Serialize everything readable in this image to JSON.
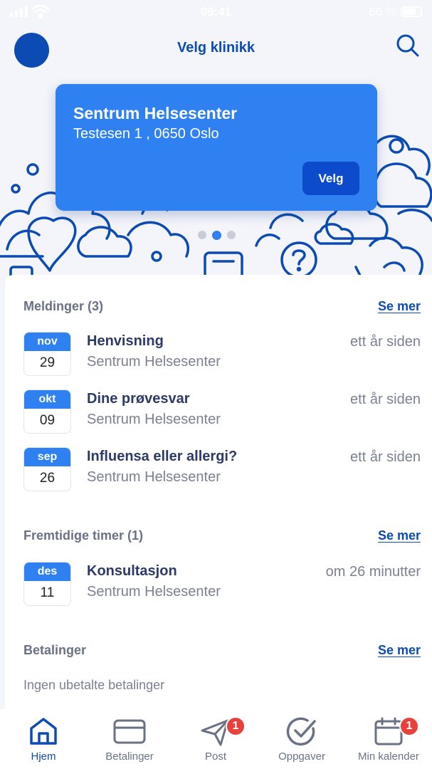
{
  "status_bar": {
    "time": "09:41",
    "battery_percent": "66 %"
  },
  "header": {
    "title": "Velg klinikk",
    "avatar_icon": "avatar",
    "search_icon": "search-icon"
  },
  "clinic_card": {
    "name": "Sentrum Helsesenter",
    "address": "Testesen 1 , 0650 Oslo",
    "select_label": "Velg",
    "pager_total": 3,
    "pager_active": 2
  },
  "messages": {
    "title": "Meldinger (3)",
    "see_more": "Se mer",
    "items": [
      {
        "month": "nov",
        "day": "29",
        "title": "Henvisning",
        "subtitle": "Sentrum Helsesenter",
        "time": "ett år siden"
      },
      {
        "month": "okt",
        "day": "09",
        "title": "Dine prøvesvar",
        "subtitle": "Sentrum Helsesenter",
        "time": "ett år siden"
      },
      {
        "month": "sep",
        "day": "26",
        "title": "Influensa eller allergi?",
        "subtitle": "Sentrum Helsesenter",
        "time": "ett år siden"
      }
    ]
  },
  "appointments": {
    "title": "Fremtidige timer (1)",
    "see_more": "Se mer",
    "items": [
      {
        "month": "des",
        "day": "11",
        "title": "Konsultasjon",
        "subtitle": "Sentrum Helsesenter",
        "time": "om 26 minutter"
      }
    ]
  },
  "payments": {
    "title": "Betalinger",
    "see_more": "Se mer",
    "empty_text": "Ingen ubetalte betalinger"
  },
  "nav": {
    "items": [
      {
        "label": "Hjem",
        "icon": "home-icon",
        "active": true
      },
      {
        "label": "Betalinger",
        "icon": "credit-card-icon"
      },
      {
        "label": "Post",
        "icon": "send-icon",
        "badge": "1"
      },
      {
        "label": "Oppgaver",
        "icon": "check-circle-icon"
      },
      {
        "label": "Min kalender",
        "icon": "calendar-icon",
        "badge": "1"
      }
    ]
  },
  "colors": {
    "primary": "#0b4bb3",
    "card": "#2f80f0",
    "badge": "#e8413c",
    "muted": "#7b8192"
  }
}
